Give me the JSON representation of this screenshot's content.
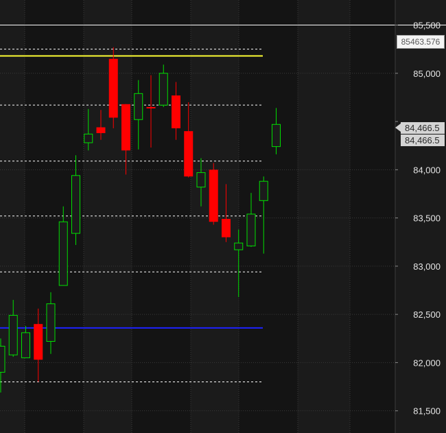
{
  "chart_data": {
    "type": "candlestick",
    "y_ticks": [
      "81,500",
      "82,000",
      "82,500",
      "83,000",
      "83,500",
      "84,000",
      "85,000",
      "85,500"
    ],
    "ylim": [
      81270,
      85760
    ],
    "candles": [
      {
        "open": 81900,
        "high": 82250,
        "low": 81690,
        "close": 82170
      },
      {
        "open": 82080,
        "high": 82650,
        "low": 82060,
        "close": 82490
      },
      {
        "open": 82050,
        "high": 82380,
        "low": 82050,
        "close": 82310
      },
      {
        "open": 82400,
        "high": 82560,
        "low": 81800,
        "close": 82030
      },
      {
        "open": 82220,
        "high": 82730,
        "low": 82090,
        "close": 82610
      },
      {
        "open": 82800,
        "high": 83620,
        "low": 82800,
        "close": 83460
      },
      {
        "open": 83340,
        "high": 84150,
        "low": 83220,
        "close": 83940
      },
      {
        "open": 84280,
        "high": 84630,
        "low": 84200,
        "close": 84370
      },
      {
        "open": 84440,
        "high": 84620,
        "low": 84310,
        "close": 84380
      },
      {
        "open": 85150,
        "high": 85270,
        "low": 84430,
        "close": 84540
      },
      {
        "open": 84680,
        "high": 84680,
        "low": 83950,
        "close": 84200
      },
      {
        "open": 84520,
        "high": 84930,
        "low": 84210,
        "close": 84790
      },
      {
        "open": 84650,
        "high": 84980,
        "low": 84230,
        "close": 84640
      },
      {
        "open": 84670,
        "high": 85090,
        "low": 84650,
        "close": 85000
      },
      {
        "open": 84770,
        "high": 84910,
        "low": 84310,
        "close": 84430
      },
      {
        "open": 84400,
        "high": 84700,
        "low": 83920,
        "close": 83930
      },
      {
        "open": 83820,
        "high": 84120,
        "low": 83620,
        "close": 83970
      },
      {
        "open": 84000,
        "high": 84070,
        "low": 83430,
        "close": 83460
      },
      {
        "open": 83490,
        "high": 83850,
        "low": 83250,
        "close": 83300
      },
      {
        "open": 83170,
        "high": 83380,
        "low": 82680,
        "close": 83240
      },
      {
        "open": 83210,
        "high": 83760,
        "low": 83200,
        "close": 83540
      },
      {
        "open": 83680,
        "high": 83930,
        "low": 83130,
        "close": 83880
      },
      {
        "open": 84240,
        "high": 84640,
        "low": 84160,
        "close": 84470
      }
    ],
    "horizontal_lines": [
      {
        "price": 85500,
        "style": "solid",
        "color": "#ffffff"
      },
      {
        "price": 85250,
        "style": "dashed",
        "color": "#ffffff"
      },
      {
        "price": 85180,
        "style": "solid",
        "color": "#ffff33"
      },
      {
        "price": 84670,
        "style": "dashed",
        "color": "#ffffff"
      },
      {
        "price": 84090,
        "style": "dashed",
        "color": "#ffffff"
      },
      {
        "price": 83520,
        "style": "dashed",
        "color": "#ffffff"
      },
      {
        "price": 82940,
        "style": "dashed",
        "color": "#ffffff"
      },
      {
        "price": 82360,
        "style": "solid",
        "color": "#1e22ff"
      },
      {
        "price": 81800,
        "style": "dashed",
        "color": "#ffffff"
      }
    ],
    "grid": true
  },
  "crosshair_price": "85463.576",
  "last_price_labels": [
    "84,466.5",
    "84,466.5"
  ],
  "colors": {
    "background": "#1b1b1b",
    "background_alt": "#141414",
    "up_candle": "#00e000",
    "down_candle": "#ff0000",
    "grid": "#3a3a3a",
    "axis_text": "#e6e6e6"
  }
}
